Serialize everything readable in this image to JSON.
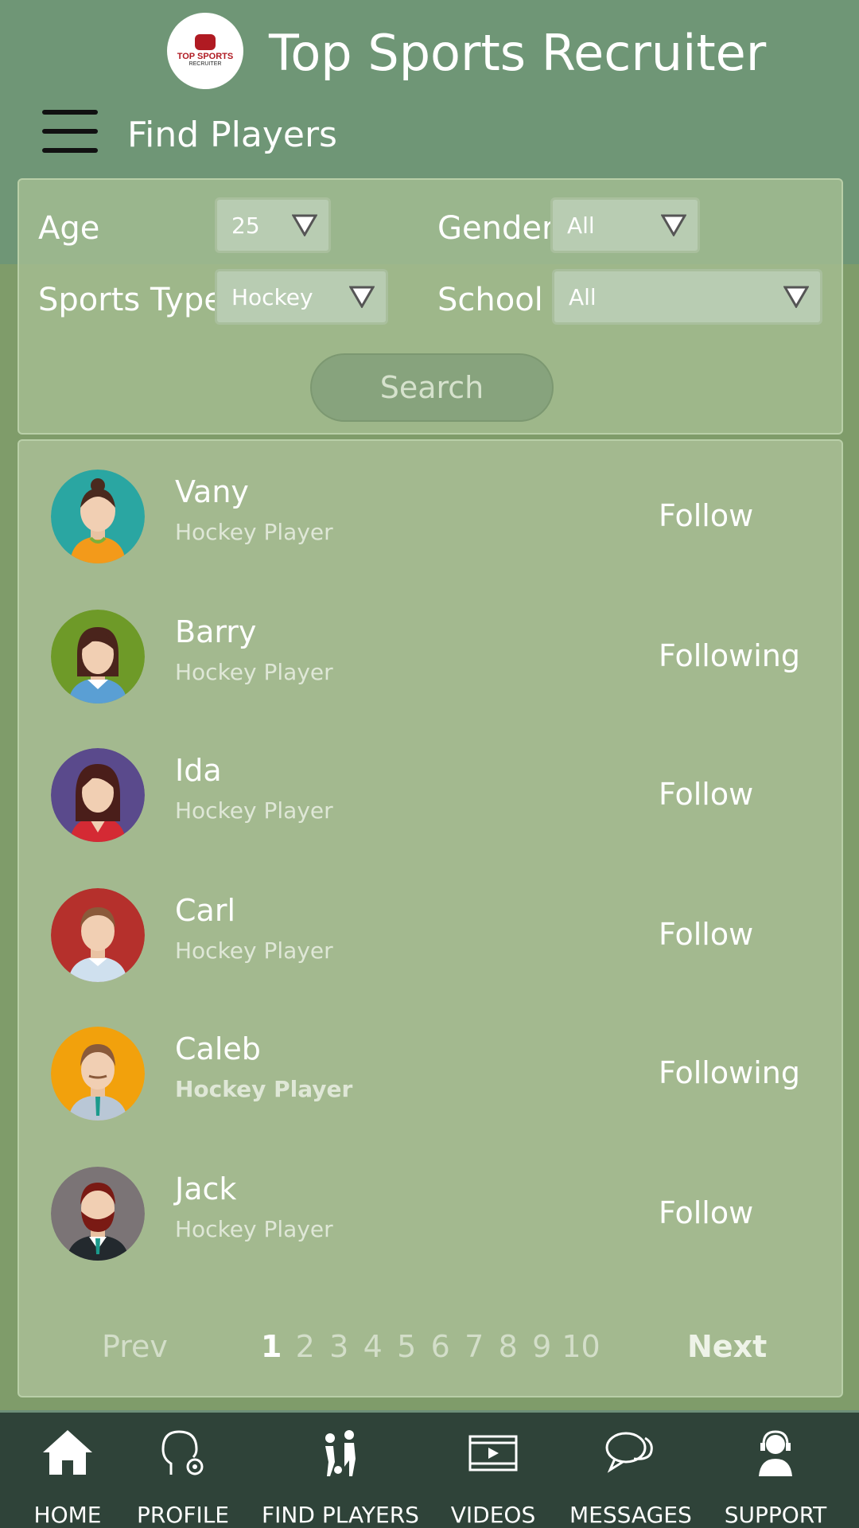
{
  "app": {
    "title": "Top Sports Recruiter",
    "logo_line1": "TOP SPORTS",
    "logo_line2": "RECRUITER"
  },
  "page": {
    "title": "Find Players"
  },
  "filters": {
    "age_label": "Age",
    "age_value": "25",
    "gender_label": "Gender",
    "gender_value": "All",
    "sports_label": "Sports Type",
    "sports_value": "Hockey",
    "school_label": "School",
    "school_value": "All",
    "search_label": "Search"
  },
  "players": [
    {
      "name": "Vany",
      "role": "Hockey Player",
      "action": "Follow",
      "avatar_bg": "#2aa6a2"
    },
    {
      "name": "Barry",
      "role": "Hockey Player",
      "action": "Following",
      "avatar_bg": "#6e9a28"
    },
    {
      "name": "Ida",
      "role": "Hockey Player",
      "action": "Follow",
      "avatar_bg": "#5a4a8c"
    },
    {
      "name": "Carl",
      "role": "Hockey Player",
      "action": "Follow",
      "avatar_bg": "#b5302c"
    },
    {
      "name": "Caleb",
      "role": "Hockey Player",
      "action": "Following",
      "avatar_bg": "#f2a10c"
    },
    {
      "name": "Jack",
      "role": "Hockey Player",
      "action": "Follow",
      "avatar_bg": "#7b7476"
    }
  ],
  "pagination": {
    "prev": "Prev",
    "next": "Next",
    "pages": [
      "1",
      "2",
      "3",
      "4",
      "5",
      "6",
      "7",
      "8",
      "9",
      "10"
    ],
    "current": "1"
  },
  "nav": [
    {
      "label": "HOME",
      "icon": "home-icon"
    },
    {
      "label": "PROFILE",
      "icon": "profile-settings-icon"
    },
    {
      "label": "FIND PLAYERS",
      "icon": "find-players-icon"
    },
    {
      "label": "VIDEOS",
      "icon": "video-icon"
    },
    {
      "label": "MESSAGES",
      "icon": "messages-icon"
    },
    {
      "label": "SUPPORT",
      "icon": "support-icon"
    }
  ]
}
